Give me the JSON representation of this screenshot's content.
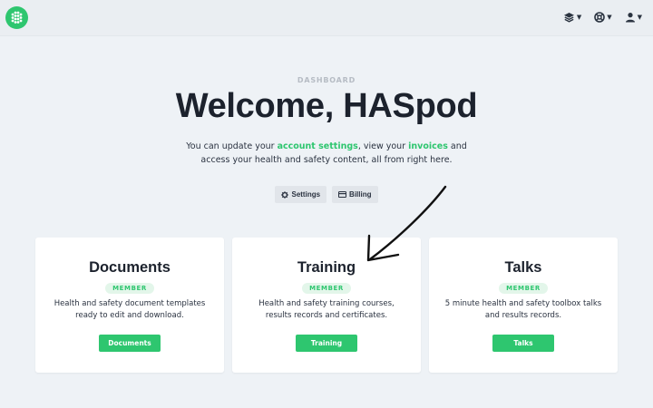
{
  "header": {
    "logo_icon": "hexagon-dots-logo",
    "menus": [
      {
        "icon": "layers-icon"
      },
      {
        "icon": "help-lifebuoy-icon"
      },
      {
        "icon": "user-icon"
      }
    ]
  },
  "hero": {
    "eyebrow": "DASHBOARD",
    "title": "Welcome, HASpod",
    "intro_pre": "You can update your ",
    "intro_link1": "account settings",
    "intro_mid": ", view your ",
    "intro_link2": "invoices",
    "intro_post": " and access your health and safety content, all from right here."
  },
  "actions": {
    "settings_label": "Settings",
    "billing_label": "Billing"
  },
  "cards": [
    {
      "title": "Documents",
      "badge": "MEMBER",
      "desc": "Health and safety document templates ready to edit and download.",
      "button": "Documents"
    },
    {
      "title": "Training",
      "badge": "MEMBER",
      "desc": "Health and safety training courses, results records and certificates.",
      "button": "Training"
    },
    {
      "title": "Talks",
      "badge": "MEMBER",
      "desc": "5 minute health and safety toolbox talks and results records.",
      "button": "Talks"
    }
  ],
  "colors": {
    "accent": "#2ec66f",
    "background": "#eef2f6",
    "text": "#1c222d"
  }
}
